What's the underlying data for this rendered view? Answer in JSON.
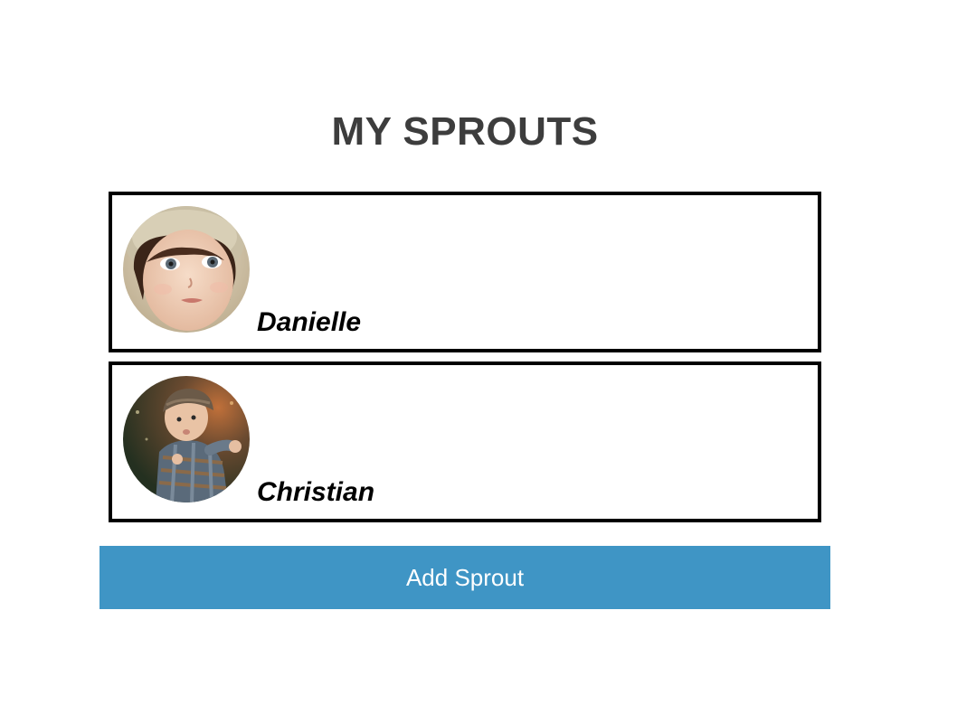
{
  "page": {
    "title": "MY SPROUTS"
  },
  "sprouts": [
    {
      "name": "Danielle",
      "avatar": "child-photo-avatar"
    },
    {
      "name": "Christian",
      "avatar": "baby-photo-avatar"
    }
  ],
  "actions": {
    "add_label": "Add Sprout"
  },
  "colors": {
    "title": "#3d3d3d",
    "card_border": "#000000",
    "button_bg": "#3f95c5",
    "button_text": "#ffffff"
  }
}
